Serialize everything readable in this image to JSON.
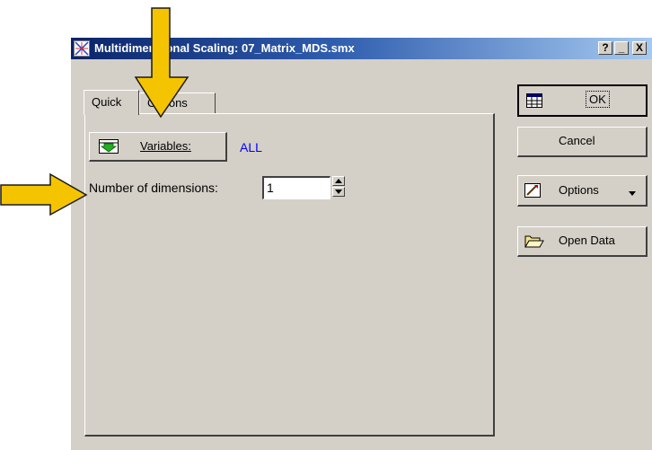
{
  "window": {
    "title": "Multidimensional Scaling: 07_Matrix_MDS.smx",
    "help_button": "?",
    "minimize_button": "_",
    "close_button": "X"
  },
  "tabs": [
    {
      "label": "Quick",
      "selected": true
    },
    {
      "label": "Options",
      "selected": false
    }
  ],
  "quick": {
    "variables_button": "Variables:",
    "variables_value": "ALL",
    "dimensions_label": "Number of dimensions:",
    "dimensions_value": "1"
  },
  "side_buttons": {
    "ok": "OK",
    "cancel": "Cancel",
    "options": "Options",
    "open_data": "Open Data"
  },
  "colors": {
    "title_gradient_start": "#0a246a",
    "title_gradient_end": "#a6caf0",
    "dialog_face": "#d4d0c8",
    "value_link": "#0000ff",
    "arrow_fill": "#f5c400",
    "arrow_outline": "#1a1a1a"
  },
  "icons": [
    "app-scatter-icon",
    "variables-icon",
    "ok-spreadsheet-icon",
    "options-wand-icon",
    "open-folder-icon",
    "spin-up-icon",
    "spin-down-icon",
    "dropdown-arrow-icon",
    "annotation-arrow-down",
    "annotation-arrow-right"
  ]
}
